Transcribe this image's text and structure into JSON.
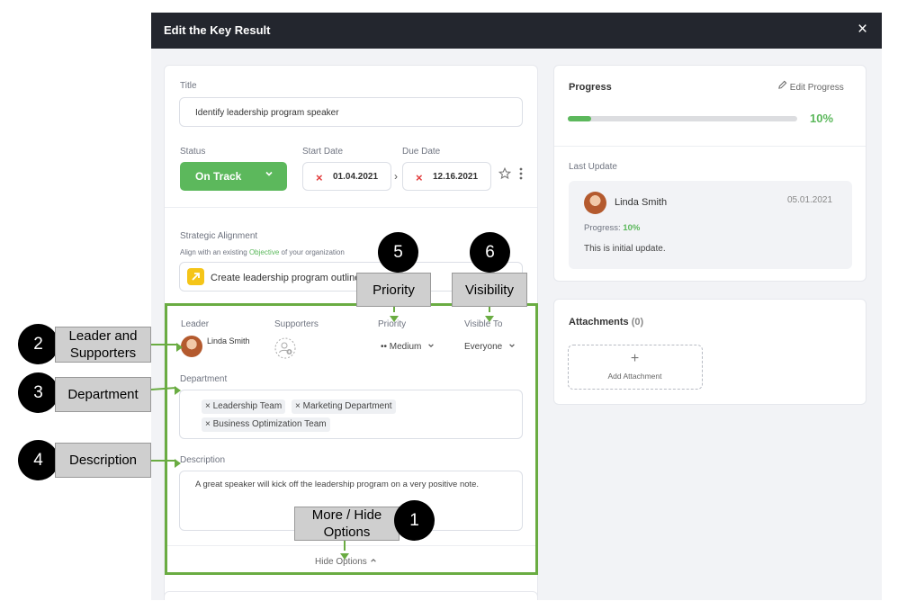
{
  "modal": {
    "title": "Edit the Key Result",
    "close_icon": "×"
  },
  "form": {
    "title_label": "Title",
    "title_value": "Identify leadership program speaker",
    "status_label": "Status",
    "status_value": "On Track",
    "start_date_label": "Start Date",
    "start_date_value": "01.04.2021",
    "due_date_label": "Due Date",
    "due_date_value": "12.16.2021",
    "alignment_label": "Strategic Alignment",
    "alignment_desc_pre": "Align with an existing ",
    "alignment_desc_link": "Objective",
    "alignment_desc_post": " of your organization",
    "alignment_value": "Create leadership program outline",
    "leader_label": "Leader",
    "leader_name": "Linda Smith",
    "supporters_label": "Supporters",
    "priority_label": "Priority",
    "priority_value": "•• Medium",
    "visible_label": "Visible To",
    "visible_value": "Everyone",
    "department_label": "Department",
    "departments": [
      "Leadership Team",
      "Marketing Department",
      "Business Optimization Team"
    ],
    "description_label": "Description",
    "description_value": "A great speaker will kick off the leadership program on a very positive note.",
    "hide_options": "Hide Options"
  },
  "progress": {
    "label": "Progress",
    "edit_label": "Edit Progress",
    "percent_text": "10%",
    "value": 0.1,
    "last_update_label": "Last Update",
    "update_user": "Linda Smith",
    "update_date": "05.01.2021",
    "update_progress_label": "Progress:",
    "update_progress_value": "10%",
    "update_text": "This is initial update."
  },
  "attachments": {
    "label": "Attachments",
    "count": "(0)",
    "add_label": "Add Attachment",
    "add_icon": "+"
  },
  "callouts": [
    {
      "num": "1",
      "label": "More / Hide Options"
    },
    {
      "num": "2",
      "label": "Leader and Supporters"
    },
    {
      "num": "3",
      "label": "Department"
    },
    {
      "num": "4",
      "label": "Description"
    },
    {
      "num": "5",
      "label": "Priority"
    },
    {
      "num": "6",
      "label": "Visibility"
    }
  ],
  "colors": {
    "accent": "#5cb85c",
    "header": "#23262e",
    "callout_frame": "#6aac42",
    "error": "#e23b3b"
  }
}
